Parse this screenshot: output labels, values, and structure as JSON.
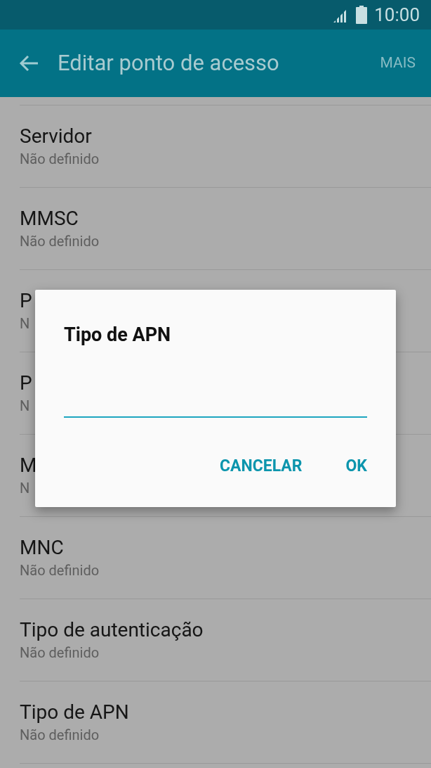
{
  "status_bar": {
    "time": "10:00"
  },
  "app_bar": {
    "title": "Editar ponto de acesso",
    "action": "MAIS"
  },
  "settings": [
    {
      "title": "Servidor",
      "value": "Não definido"
    },
    {
      "title": "MMSC",
      "value": "Não definido"
    },
    {
      "title": "P",
      "value": "N"
    },
    {
      "title": "P",
      "value": "N"
    },
    {
      "title": "M",
      "value": "N"
    },
    {
      "title": "MNC",
      "value": "Não definido"
    },
    {
      "title": "Tipo de autenticação",
      "value": "Não definido"
    },
    {
      "title": "Tipo de APN",
      "value": "Não definido"
    }
  ],
  "dialog": {
    "title": "Tipo de APN",
    "buttons": [
      "CANCELAR",
      "OK"
    ]
  }
}
